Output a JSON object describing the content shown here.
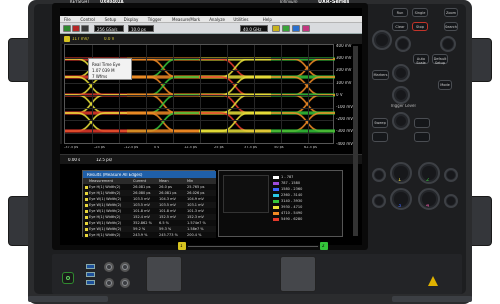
{
  "brand": {
    "name": "KEYSIGHT",
    "model": "UXR0402A",
    "subtitle": "Real-Time Oscilloscope",
    "spec": "20 GHz · 256 GSa/s · 10-bit",
    "label_right": "Infiniium",
    "series": "UXR-Series"
  },
  "menu": [
    "File",
    "Control",
    "Setup",
    "Display",
    "Trigger",
    "Measure/Mark",
    "Analyze",
    "Utilities",
    "Help"
  ],
  "toolbar": {
    "sample_rate": "256 GSa/s",
    "time_div": "10.0 ps",
    "bandwidth": "40.0 GHz"
  },
  "channel": {
    "id": "1",
    "scale": "117 mV/",
    "offset": "0.0 V"
  },
  "tooltip": {
    "line1": "Real Time Eye",
    "line2": "1.07 039 M",
    "line3": "7 Wfms"
  },
  "y_axis": [
    "400 mV",
    "300 mV",
    "200 mV",
    "100 mV",
    "0 V",
    "-100 mV",
    "-200 mV",
    "-300 mV",
    "-400 mV"
  ],
  "x_axis": [
    "-37.5 ps",
    "-25 ps",
    "-12.5 ps",
    "0 s",
    "12.5 ps",
    "25 ps",
    "37.5 ps",
    "50 ps",
    "62.5 ps"
  ],
  "timebase": {
    "position": "0.00 s",
    "scale": "12.5 ps/"
  },
  "results": {
    "title": "Results (Measure All Edges)",
    "columns": [
      "Measurement",
      "Current",
      "Mean",
      "Min"
    ],
    "rows": [
      [
        "Eye H(1) Width(2)",
        "26.081 ps",
        "26.0 ps",
        "25.765 ps"
      ],
      [
        "Eye H(1) Width(2)",
        "26.080 ps",
        "26.081 ps",
        "26.026 ps"
      ],
      [
        "Eye W(1) Width(2)",
        "103.5 mV",
        "104.3 mV",
        "104.9 mV"
      ],
      [
        "Eye W(1) Width(2)",
        "103.5 mV",
        "103.5 mV",
        "103.1 mV"
      ],
      [
        "Eye W(1) Width(2)",
        "101.8 mV",
        "101.8 mV",
        "101.3 mV"
      ],
      [
        "Eye H(1) Width(2)",
        "152.4 mV",
        "152.5 mV",
        "152.3 mV"
      ],
      [
        "Eye W(1) Width(2)",
        "352.862 %",
        "6.5 %",
        "1.574e7 %"
      ],
      [
        "Eye W(1) Width(2)",
        "59.2 %",
        "59.3 %",
        "1.58e7 %"
      ],
      [
        "Eye H(1) Width(2)",
        "243.9 %",
        "245.773 %",
        "200.4 %"
      ]
    ]
  },
  "histogram_legend": [
    {
      "label": "1 - 787",
      "color": "#ffffff"
    },
    {
      "label": "787 - 1580",
      "color": "#9c4bd8"
    },
    {
      "label": "1580 - 2360",
      "color": "#3d66ff"
    },
    {
      "label": "2360 - 3140",
      "color": "#29c7e6"
    },
    {
      "label": "3140 - 3930",
      "color": "#34c43a"
    },
    {
      "label": "3930 - 4710",
      "color": "#e8e13a"
    },
    {
      "label": "4710 - 5490",
      "color": "#f08a24"
    },
    {
      "label": "5490 - 6280",
      "color": "#e53a2b"
    }
  ],
  "panel": {
    "run": "Run",
    "stop": "Stop",
    "single": "Single",
    "clear": "Clear",
    "horizontal": "Horizontal",
    "zoom": "Zoom",
    "search": "Search",
    "multi": "Multi Purpose",
    "auto_scale": "Auto Scale",
    "default": "Default Setup",
    "markers": "Markers",
    "position": "Position",
    "trigger_level": "Trigger Level",
    "mode": "Mode",
    "sweep": "Sweep",
    "channel1": "1",
    "channel2": "2",
    "channel3": "3",
    "channel4": "4"
  },
  "inputs": {
    "ch1": "1",
    "ch2": "2"
  },
  "colors": {
    "frame": "#2b2c2e",
    "screen": "#000000",
    "accent": "#1f5fa8",
    "eye_yellow": "#e8e13a",
    "eye_red": "#e53a2b",
    "eye_green": "#34c43a"
  }
}
